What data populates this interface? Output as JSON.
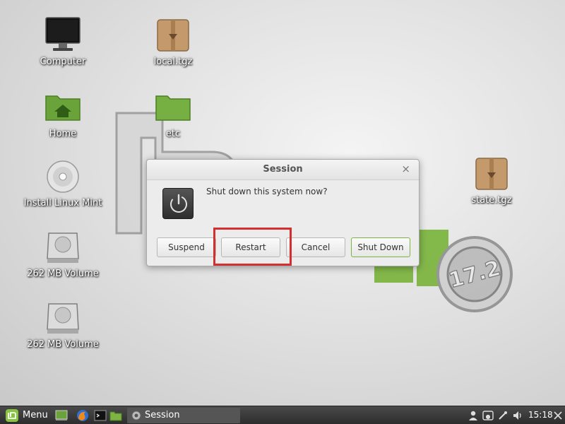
{
  "desktop": {
    "icons": [
      {
        "label": "Computer"
      },
      {
        "label": "local.tgz"
      },
      {
        "label": "Home"
      },
      {
        "label": "etc"
      },
      {
        "label": "Install Linux Mint"
      },
      {
        "label": "state.tgz"
      },
      {
        "label": "262 MB Volume"
      },
      {
        "label": "262 MB Volume"
      }
    ],
    "wallpaper_version": "17.2"
  },
  "dialog": {
    "title": "Session",
    "close_glyph": "×",
    "message": "Shut down this system now?",
    "icon": "power-icon",
    "buttons": {
      "suspend": "Suspend",
      "restart": "Restart",
      "cancel": "Cancel",
      "shutdown": "Shut Down"
    }
  },
  "taskbar": {
    "menu_label": "Menu",
    "launchers": [
      "show-desktop-icon",
      "firefox-icon",
      "terminal-icon",
      "files-icon"
    ],
    "tasks": [
      {
        "label": "Session"
      }
    ],
    "tray_icons": [
      "user-icon",
      "keyboard-layout-icon",
      "update-manager-icon",
      "network-icon",
      "volume-icon"
    ],
    "clock": "15:18"
  },
  "colors": {
    "accent": "#87c442",
    "highlight": "#d32f2f",
    "taskbar": "#3a3a3a"
  }
}
